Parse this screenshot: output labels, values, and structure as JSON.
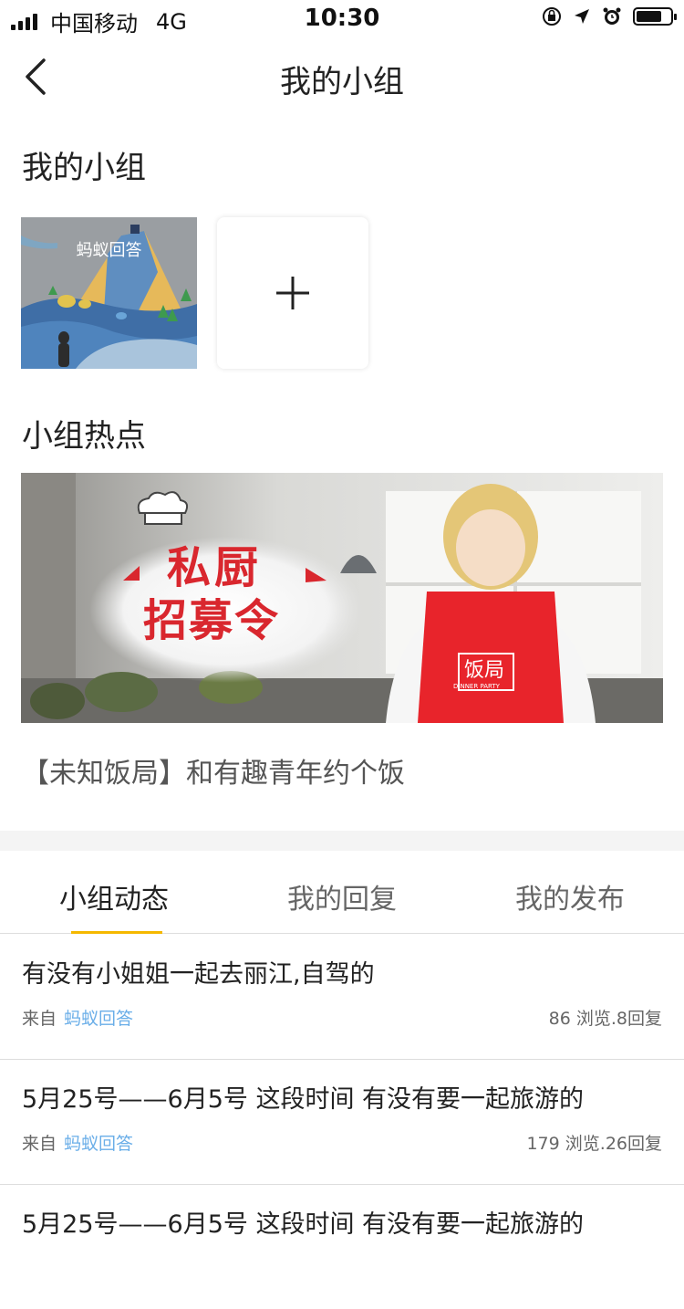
{
  "status_bar": {
    "carrier": "中国移动",
    "network": "4G",
    "time": "10:30",
    "battery_level": 0.75
  },
  "nav": {
    "title": "我的小组"
  },
  "my_groups": {
    "section_title": "我的小组",
    "groups": [
      {
        "name": "蚂蚁回答"
      }
    ]
  },
  "hot": {
    "section_title": "小组热点",
    "banner": {
      "headline_line1": "私厨",
      "headline_line2": "招募令",
      "apron_text": "饭局",
      "apron_subtext": "DINNER PARTY"
    },
    "caption": "【未知饭局】和有趣青年约个饭"
  },
  "tabs": [
    {
      "label": "小组动态",
      "active": true
    },
    {
      "label": "我的回复",
      "active": false
    },
    {
      "label": "我的发布",
      "active": false
    }
  ],
  "accent_color": "#f5b800",
  "link_color": "#6aaee8",
  "posts": [
    {
      "title": "有没有小姐姐一起去丽江,自驾的",
      "from_label": "来自",
      "group": "蚂蚁回答",
      "stats": "86 浏览.8回复"
    },
    {
      "title": "5月25号——6月5号 这段时间 有没有要一起旅游的",
      "from_label": "来自",
      "group": "蚂蚁回答",
      "stats": "179 浏览.26回复"
    },
    {
      "title": "5月25号——6月5号 这段时间 有没有要一起旅游的",
      "from_label": "",
      "group": "",
      "stats": ""
    }
  ]
}
